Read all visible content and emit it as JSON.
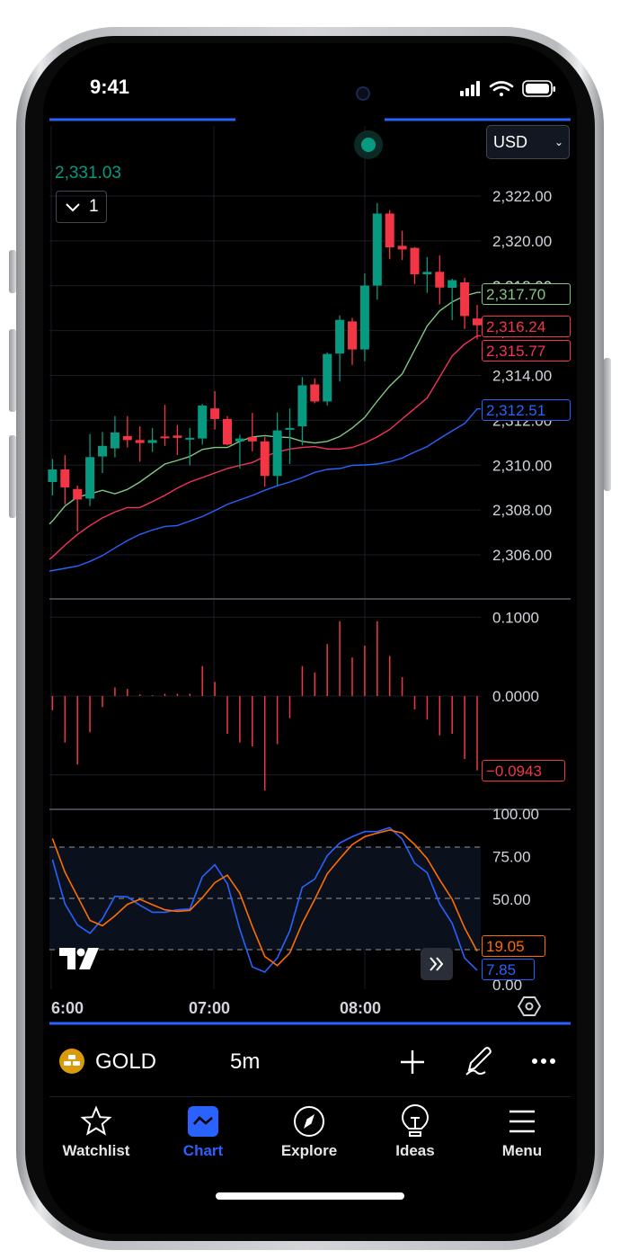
{
  "status_bar": {
    "time": "9:41"
  },
  "header": {
    "currency": "USD",
    "last_value": "2,331.03",
    "collapse_count": "1"
  },
  "colors": {
    "up": "#089981",
    "down": "#f23645",
    "ma_fast": "#81c784",
    "ma_mid": "#f7325b",
    "ma_slow": "#2962ff",
    "stoch_k": "#2962ff",
    "stoch_d": "#ff6d00",
    "accent": "#2962ff"
  },
  "chart_data": [
    {
      "type": "candlestick",
      "yticks": [
        "2,322.00",
        "2,320.00",
        "2,318.00",
        "2,316.00",
        "2,314.00",
        "2,312.00",
        "2,310.00",
        "2,308.00",
        "2,306.00"
      ],
      "ytick_values": [
        2322,
        2320,
        2318,
        2316,
        2314,
        2312,
        2310,
        2308,
        2306
      ],
      "ylim": [
        2304.6,
        2323.8
      ],
      "xticks": [
        "6:00",
        "07:00",
        "08:00"
      ],
      "grid": true,
      "ohlc": [
        [
          2309.25,
          2309.81,
          2310.28,
          2308.65
        ],
        [
          2309.81,
          2309.01,
          2310.45,
          2308.25
        ],
        [
          2308.94,
          2308.47,
          2309.09,
          2307.04
        ],
        [
          2308.51,
          2310.36,
          2311.39,
          2308.18
        ],
        [
          2310.39,
          2310.86,
          2311.48,
          2309.65
        ],
        [
          2310.75,
          2311.46,
          2312.19,
          2310.35
        ],
        [
          2311.3,
          2311.12,
          2312.19,
          2310.79
        ],
        [
          2311.12,
          2310.99,
          2311.73,
          2310.16
        ],
        [
          2310.99,
          2311.12,
          2311.66,
          2310.59
        ],
        [
          2311.28,
          2311.22,
          2312.69,
          2310.86
        ],
        [
          2311.32,
          2311.22,
          2311.79,
          2310.45
        ],
        [
          2311.19,
          2311.22,
          2311.66,
          2309.99
        ],
        [
          2311.19,
          2312.66,
          2312.73,
          2310.92
        ],
        [
          2312.53,
          2312.06,
          2313.3,
          2311.59
        ],
        [
          2312.06,
          2310.92,
          2312.19,
          2310.88
        ],
        [
          2311.06,
          2311.19,
          2311.36,
          2309.85
        ],
        [
          2311.26,
          2311.06,
          2312.33,
          2310.62
        ],
        [
          2311.06,
          2309.52,
          2311.26,
          2309.05
        ],
        [
          2309.52,
          2311.55,
          2312.35,
          2309.09
        ],
        [
          2311.59,
          2311.66,
          2312.53,
          2310.05
        ],
        [
          2311.73,
          2313.56,
          2313.93,
          2310.88
        ],
        [
          2313.6,
          2312.84,
          2313.87,
          2312.76
        ],
        [
          2312.84,
          2314.96,
          2315.03,
          2312.66
        ],
        [
          2314.98,
          2316.48,
          2316.68,
          2313.73
        ],
        [
          2316.41,
          2315.16,
          2316.57,
          2314.47
        ],
        [
          2315.16,
          2318.01,
          2318.55,
          2314.63
        ],
        [
          2318.01,
          2321.22,
          2321.69,
          2317.38
        ],
        [
          2321.22,
          2319.71,
          2321.38,
          2319.18
        ],
        [
          2319.78,
          2319.62,
          2320.45,
          2319.15
        ],
        [
          2319.69,
          2318.51,
          2319.73,
          2318.08
        ],
        [
          2318.51,
          2318.62,
          2319.28,
          2317.68
        ],
        [
          2318.62,
          2317.92,
          2319.35,
          2317.17
        ],
        [
          2317.91,
          2318.25,
          2318.31,
          2316.47
        ],
        [
          2318.15,
          2316.65,
          2318.35,
          2316.07
        ],
        [
          2316.54,
          2316.24,
          2317.14,
          2315.61
        ]
      ],
      "series": [
        {
          "color_key": "ma_fast",
          "last_label": "2,317.70",
          "values": [
            2307.51,
            2308.18,
            2308.58,
            2308.72,
            2308.88,
            2308.72,
            2308.92,
            2309.25,
            2309.65,
            2310.05,
            2310.21,
            2310.39,
            2310.7,
            2310.79,
            2310.79,
            2311.06,
            2311.26,
            2311.32,
            2311.26,
            2311.23,
            2311.06,
            2310.99,
            2311.06,
            2311.28,
            2311.66,
            2312.13,
            2312.86,
            2313.53,
            2314.07,
            2315.14,
            2316.21,
            2316.88,
            2317.28,
            2317.55,
            2317.7
          ]
        },
        {
          "color_key": "ma_mid",
          "last_label": "2,315.77",
          "values": [
            2305.91,
            2306.44,
            2306.91,
            2307.31,
            2307.65,
            2307.91,
            2308.11,
            2308.11,
            2308.38,
            2308.65,
            2308.98,
            2309.25,
            2309.45,
            2309.65,
            2309.85,
            2309.99,
            2310.12,
            2310.39,
            2310.59,
            2310.72,
            2310.79,
            2310.83,
            2310.72,
            2310.72,
            2310.79,
            2310.99,
            2311.26,
            2311.59,
            2312.06,
            2312.53,
            2313.0,
            2313.93,
            2314.87,
            2315.4,
            2315.77
          ]
        },
        {
          "color_key": "ma_slow",
          "last_label": "2,312.51",
          "values": [
            2305.3,
            2305.4,
            2305.5,
            2305.71,
            2305.97,
            2306.31,
            2306.64,
            2306.91,
            2307.11,
            2307.27,
            2307.31,
            2307.51,
            2307.71,
            2307.98,
            2308.25,
            2308.45,
            2308.65,
            2308.88,
            2309.08,
            2309.25,
            2309.45,
            2309.68,
            2309.81,
            2309.85,
            2309.99,
            2310.01,
            2310.05,
            2310.15,
            2310.32,
            2310.59,
            2310.83,
            2311.19,
            2311.53,
            2311.86,
            2312.51
          ]
        }
      ],
      "last_price_label": "2,316.24"
    },
    {
      "type": "bar",
      "yticks": [
        "0.1000",
        "0.0000"
      ],
      "ytick_values": [
        0.1,
        0.0
      ],
      "last_label": "−0.0943",
      "values": [
        -0.018,
        -0.059,
        -0.087,
        -0.046,
        -0.014,
        0.011,
        0.009,
        0.002,
        0.001,
        0.003,
        0.003,
        0.003,
        0.038,
        0.018,
        -0.048,
        -0.059,
        -0.064,
        -0.12,
        -0.061,
        -0.028,
        0.038,
        0.03,
        0.066,
        0.095,
        0.049,
        0.064,
        0.095,
        0.051,
        0.024,
        -0.017,
        -0.03,
        -0.05,
        -0.048,
        -0.08,
        -0.0943
      ]
    },
    {
      "type": "line",
      "yticks": [
        "100.00",
        "75.00",
        "50.00",
        "0.00"
      ],
      "ytick_values": [
        100,
        75,
        50,
        0
      ],
      "ylim": [
        0,
        100
      ],
      "bands": [
        20,
        50,
        80
      ],
      "series": [
        {
          "color_key": "stoch_k",
          "last_label": "7.85",
          "values": [
            72.7,
            46.8,
            34.5,
            29.6,
            38.0,
            51.2,
            50.9,
            46.0,
            41.9,
            41.9,
            43.3,
            43.8,
            62.7,
            69.7,
            58.6,
            31.9,
            9.9,
            6.9,
            15.1,
            31.0,
            56.5,
            61.3,
            75.0,
            82.4,
            86.1,
            89.1,
            89.1,
            91.4,
            84.7,
            70.6,
            65.0,
            46.8,
            35.4,
            15.1,
            7.85
          ]
        },
        {
          "color_key": "stoch_d",
          "last_label": "19.05",
          "values": [
            85.0,
            65.3,
            51.2,
            37.1,
            34.0,
            39.8,
            46.5,
            49.5,
            46.3,
            43.3,
            42.4,
            43.0,
            50.4,
            59.2,
            63.6,
            53.0,
            33.6,
            16.0,
            10.7,
            18.1,
            35.4,
            49.5,
            64.4,
            73.2,
            81.5,
            86.1,
            88.2,
            90.0,
            88.2,
            81.5,
            73.2,
            60.9,
            49.5,
            32.7,
            19.05
          ]
        }
      ]
    }
  ],
  "toolbar": {
    "symbol": "GOLD",
    "interval": "5m"
  },
  "tabs": [
    {
      "label": "Watchlist",
      "icon": "star-icon"
    },
    {
      "label": "Chart",
      "icon": "chart-icon",
      "active": true
    },
    {
      "label": "Explore",
      "icon": "compass-icon"
    },
    {
      "label": "Ideas",
      "icon": "lightbulb-icon"
    },
    {
      "label": "Menu",
      "icon": "menu-icon"
    }
  ]
}
